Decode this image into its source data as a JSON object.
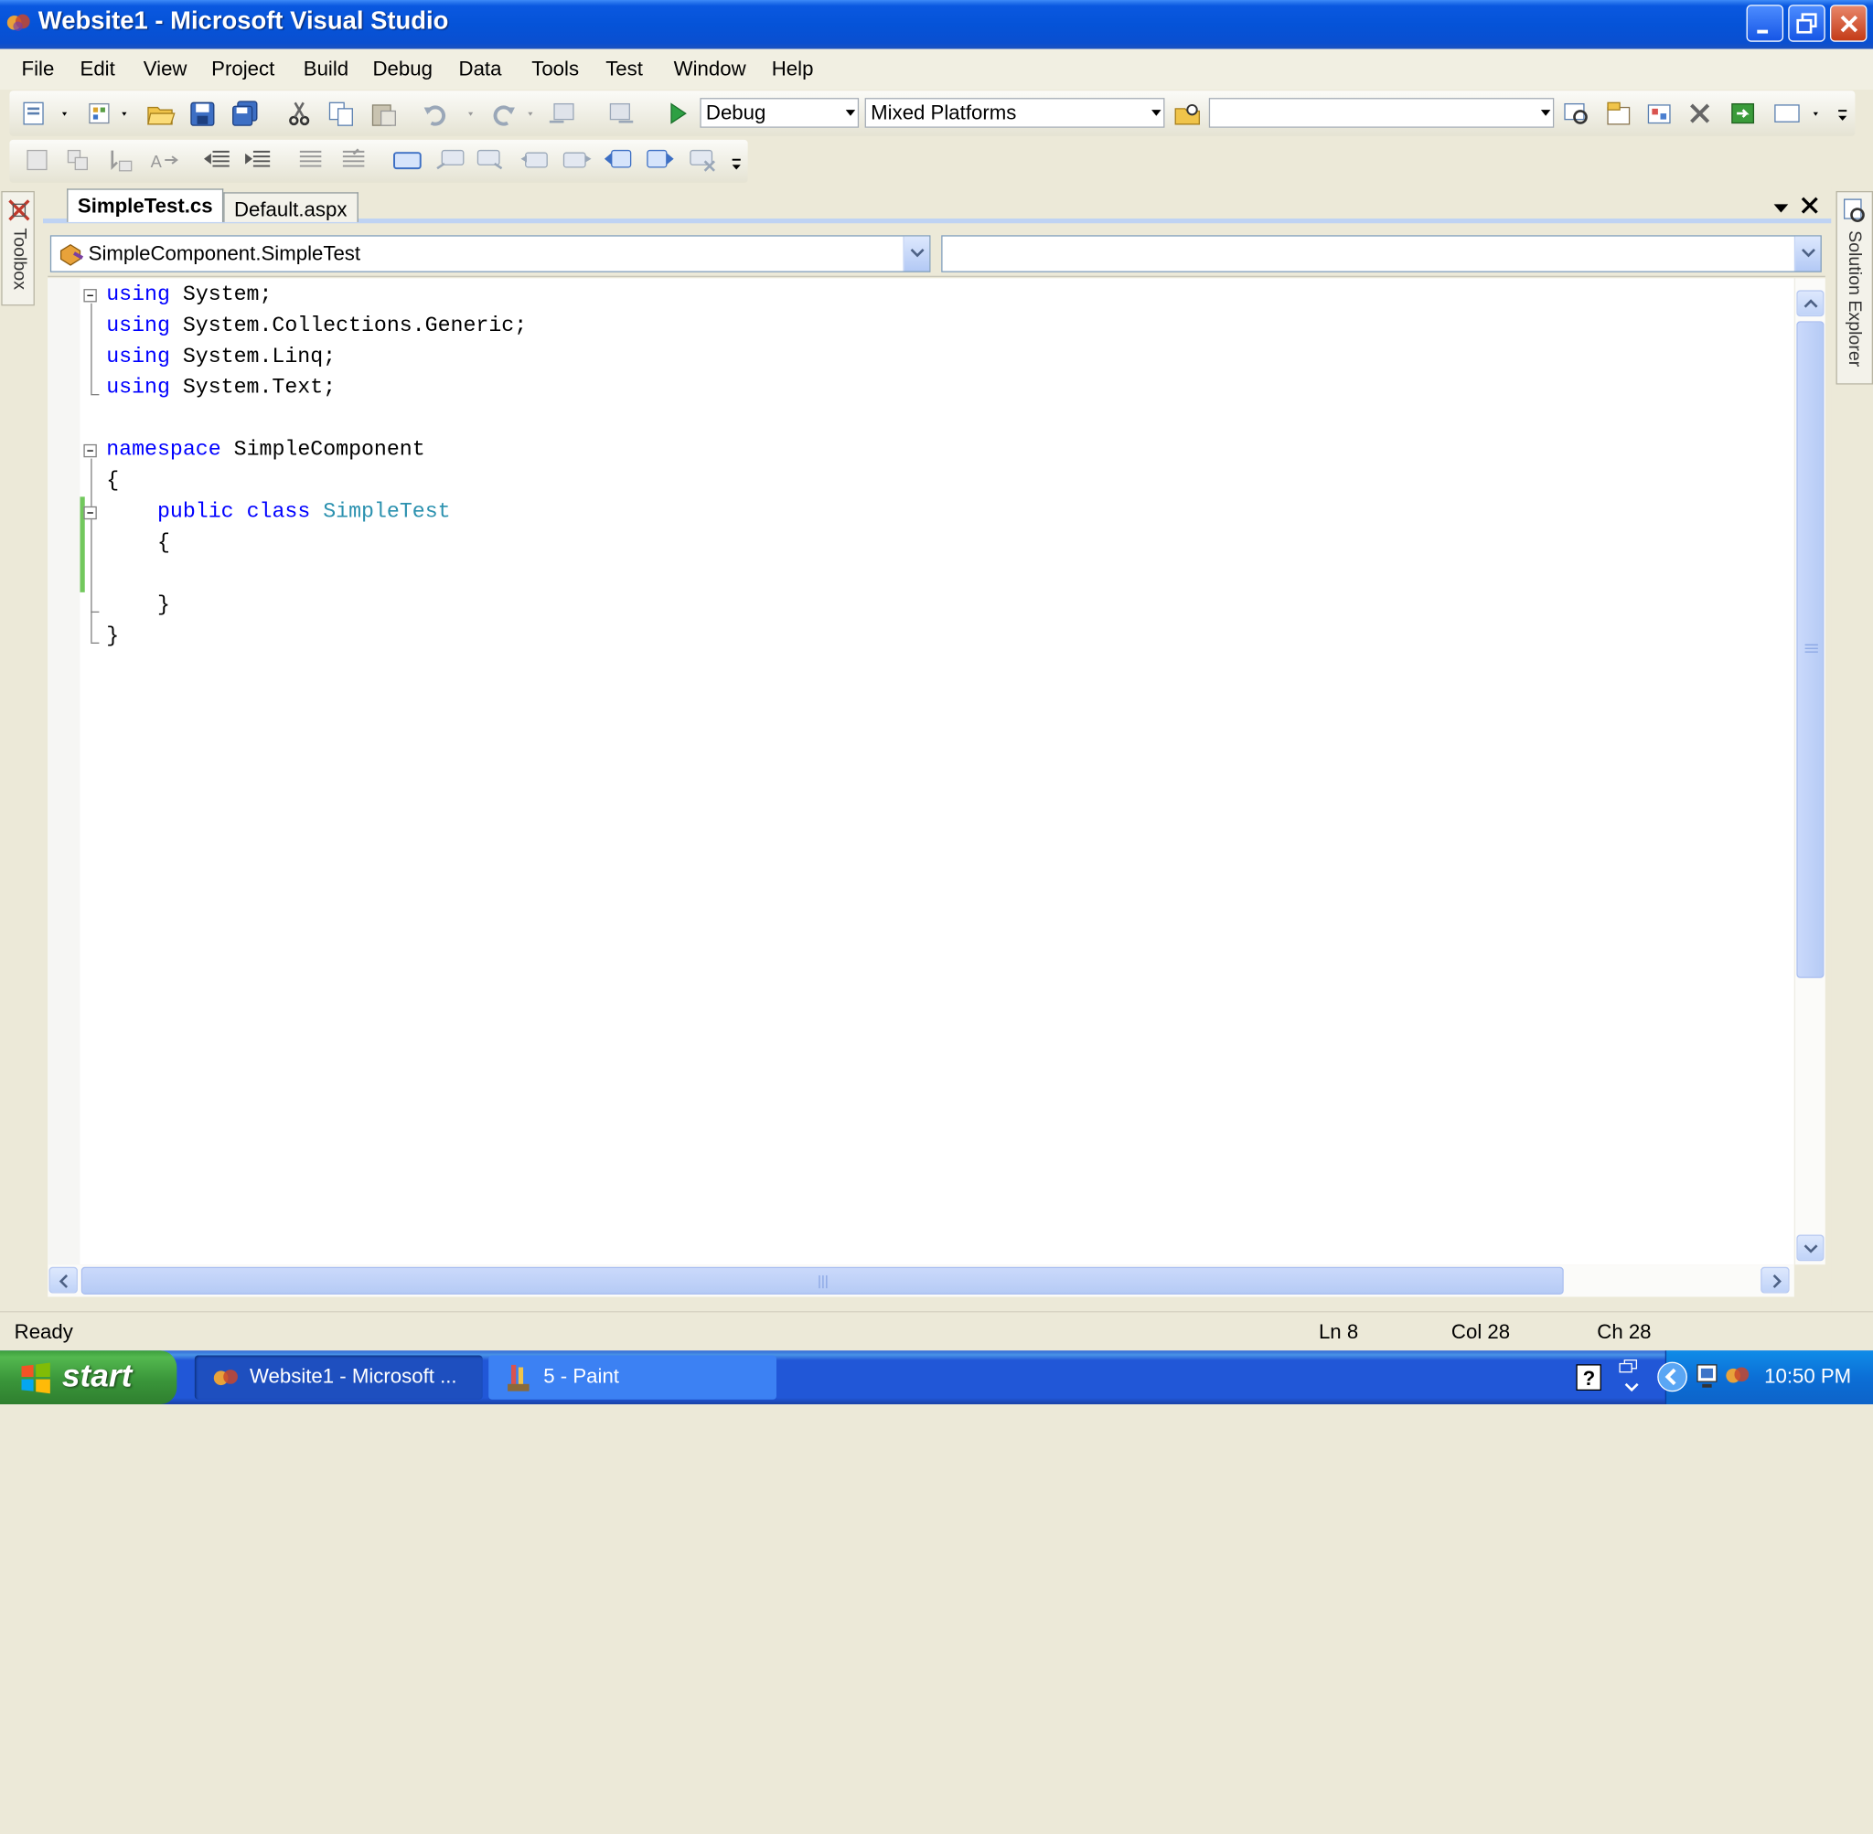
{
  "window": {
    "title": "Website1 - Microsoft Visual Studio"
  },
  "menu": {
    "items": [
      "File",
      "Edit",
      "View",
      "Project",
      "Build",
      "Debug",
      "Data",
      "Tools",
      "Test",
      "Window",
      "Help"
    ]
  },
  "toolbar": {
    "configuration": "Debug",
    "platform": "Mixed Platforms",
    "find_value": ""
  },
  "side_panels": {
    "toolbox": "Toolbox",
    "solution_explorer": "Solution Explorer"
  },
  "tabs": [
    {
      "label": "SimpleTest.cs",
      "active": true
    },
    {
      "label": "Default.aspx",
      "active": false
    }
  ],
  "navigation": {
    "type_selector": "SimpleComponent.SimpleTest",
    "member_selector": ""
  },
  "code": {
    "lines": [
      "using System;",
      "using System.Collections.Generic;",
      "using System.Linq;",
      "using System.Text;",
      "",
      "namespace SimpleComponent",
      "{",
      "    public class SimpleTest",
      "    {",
      "",
      "    }",
      "}"
    ]
  },
  "status": {
    "message": "Ready",
    "line": "Ln 8",
    "column": "Col 28",
    "char": "Ch 28"
  },
  "taskbar": {
    "start_label": "start",
    "tasks": [
      "Website1 - Microsoft ...",
      "5 - Paint"
    ],
    "clock": "10:50 PM"
  },
  "colors": {
    "keyword": "#0000ff",
    "type_name": "#2b91af",
    "titlebar": "#0553d8",
    "change_marker": "#72c85d"
  }
}
